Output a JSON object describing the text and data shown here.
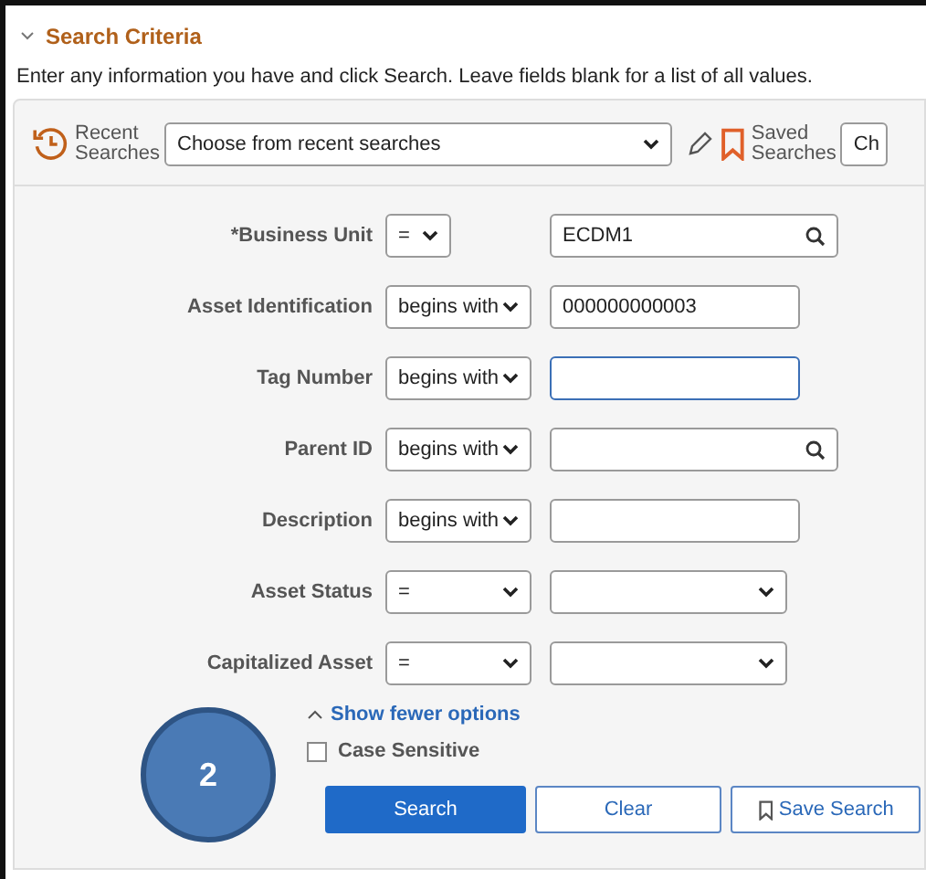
{
  "section": {
    "title": "Search Criteria",
    "expanded": true
  },
  "instructions": "Enter any information you have and click Search. Leave fields blank for a list of all values.",
  "recent_searches": {
    "label": "Recent Searches",
    "value": "Choose from recent searches"
  },
  "saved_searches": {
    "label": "Saved Searches",
    "value": "Ch"
  },
  "fields": [
    {
      "label": "*Business Unit",
      "operator": "=",
      "compact": true,
      "kind": "lookup",
      "value": "ECDM1",
      "focused": false
    },
    {
      "label": "Asset Identification",
      "operator": "begins with",
      "compact": false,
      "kind": "text",
      "value": "000000000003",
      "focused": false
    },
    {
      "label": "Tag Number",
      "operator": "begins with",
      "compact": false,
      "kind": "text",
      "focused": true
    },
    {
      "label": "Parent ID",
      "operator": "begins with",
      "compact": false,
      "kind": "lookup",
      "focused": false
    },
    {
      "label": "Description",
      "operator": "begins with",
      "compact": false,
      "kind": "text",
      "focused": false
    },
    {
      "label": "Asset Status",
      "operator": "=",
      "compact": false,
      "kind": "select",
      "focused": false
    },
    {
      "label": "Capitalized Asset",
      "operator": "=",
      "compact": false,
      "kind": "select",
      "focused": false
    }
  ],
  "show_options": {
    "label": "Show fewer options",
    "expanded": true
  },
  "case_sensitive": {
    "label": "Case Sensitive",
    "checked": false
  },
  "buttons": [
    {
      "label": "Search",
      "kind": "primary"
    },
    {
      "label": "Clear",
      "kind": "secondary"
    },
    {
      "label": "Save Search",
      "kind": "save"
    }
  ],
  "step_badge": "2"
}
